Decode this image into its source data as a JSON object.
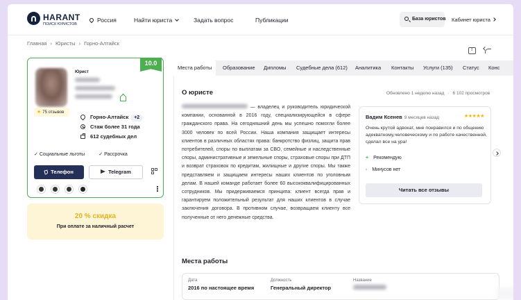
{
  "header": {
    "logo_title": "HARANT",
    "logo_subtitle": "ПОИСК ЮРИСТОВ",
    "region": "Россия",
    "nav": [
      "Найти юриста",
      "Задать вопрос",
      "Публикации"
    ],
    "base_button": "База юристов",
    "cabinet": "Кабинет юриста"
  },
  "breadcrumbs": [
    "Главная",
    "Юристы",
    "Горно-Алтайск"
  ],
  "profile": {
    "role": "Юрист",
    "score": "10.0",
    "reviews_count": "75 отзывов",
    "city": "Горно-Алтайск",
    "city_extra": "+2",
    "experience": "Стаж более 31 года",
    "cases": "612 судебных дел",
    "benefits": [
      "Социальные льготы",
      "Рассрочка"
    ],
    "phone_button": "Телефон",
    "telegram_button": "Telegram"
  },
  "discount": {
    "percent": "20 % скидка",
    "text": "При оплате за наличный расчет"
  },
  "tabs": [
    "Места работы",
    "Образование",
    "Дипломы",
    "Судебные дела (612)",
    "Аналитика",
    "Контакты",
    "Услуги (135)",
    "Статус",
    "Конс"
  ],
  "about": {
    "title": "О юристе",
    "updated": "Обновлено 1 неделю назад",
    "views": "6 102 просмотров",
    "text": "— владелец и руководитель юридической компании, основанной в 2016 году, специализирующейся в сфере гражданского права. На сегодняшний день мы успешно помогли более 3000 человек по всей России. Наша компания защищает интересы клиентов в различных областях права: банкротство физлиц, защита прав потребителей, споры по выплатам за СВО, семейные и наследственные споры, административные и земельные споры, страховые споры при ДТП и возврат страховок по кредитам, жилищные и другие споры. Мы также представляем и защищаем интересы наших клиентов по уголовным делам. В нашей команде работает более 60 высококвалифицированных сотрудников. Мы придерживаемся принципа: клиент всегда прав и гарантируем положительный результат для наших клиентов в случае заключения договора. В противном случае, возвращаем клиенту все полученные от него денежные средства."
  },
  "review": {
    "author": "Вадим Ксенев",
    "when": "9 месяцев назад",
    "stars": "★★★★★",
    "text": "Очень крутой адвокат, мне понравился и по общению адекватному,человеческому и по работе качественной, сделал все на ура!",
    "pro_sign": "+",
    "pro": "Рекомендую",
    "con_sign": "-",
    "con": "Минусов нет",
    "button": "Читать все отзывы"
  },
  "work": {
    "title": "Места работы",
    "date_label": "Дата",
    "date_value": "2016 по настоящее время",
    "position_label": "Должность",
    "position_value": "Генеральный директор",
    "name_label": "Название"
  },
  "colors": {
    "accent_green": "#4caf50",
    "navy": "#243057",
    "discount_gold": "#e0b325",
    "background": "#e7dcf5"
  }
}
